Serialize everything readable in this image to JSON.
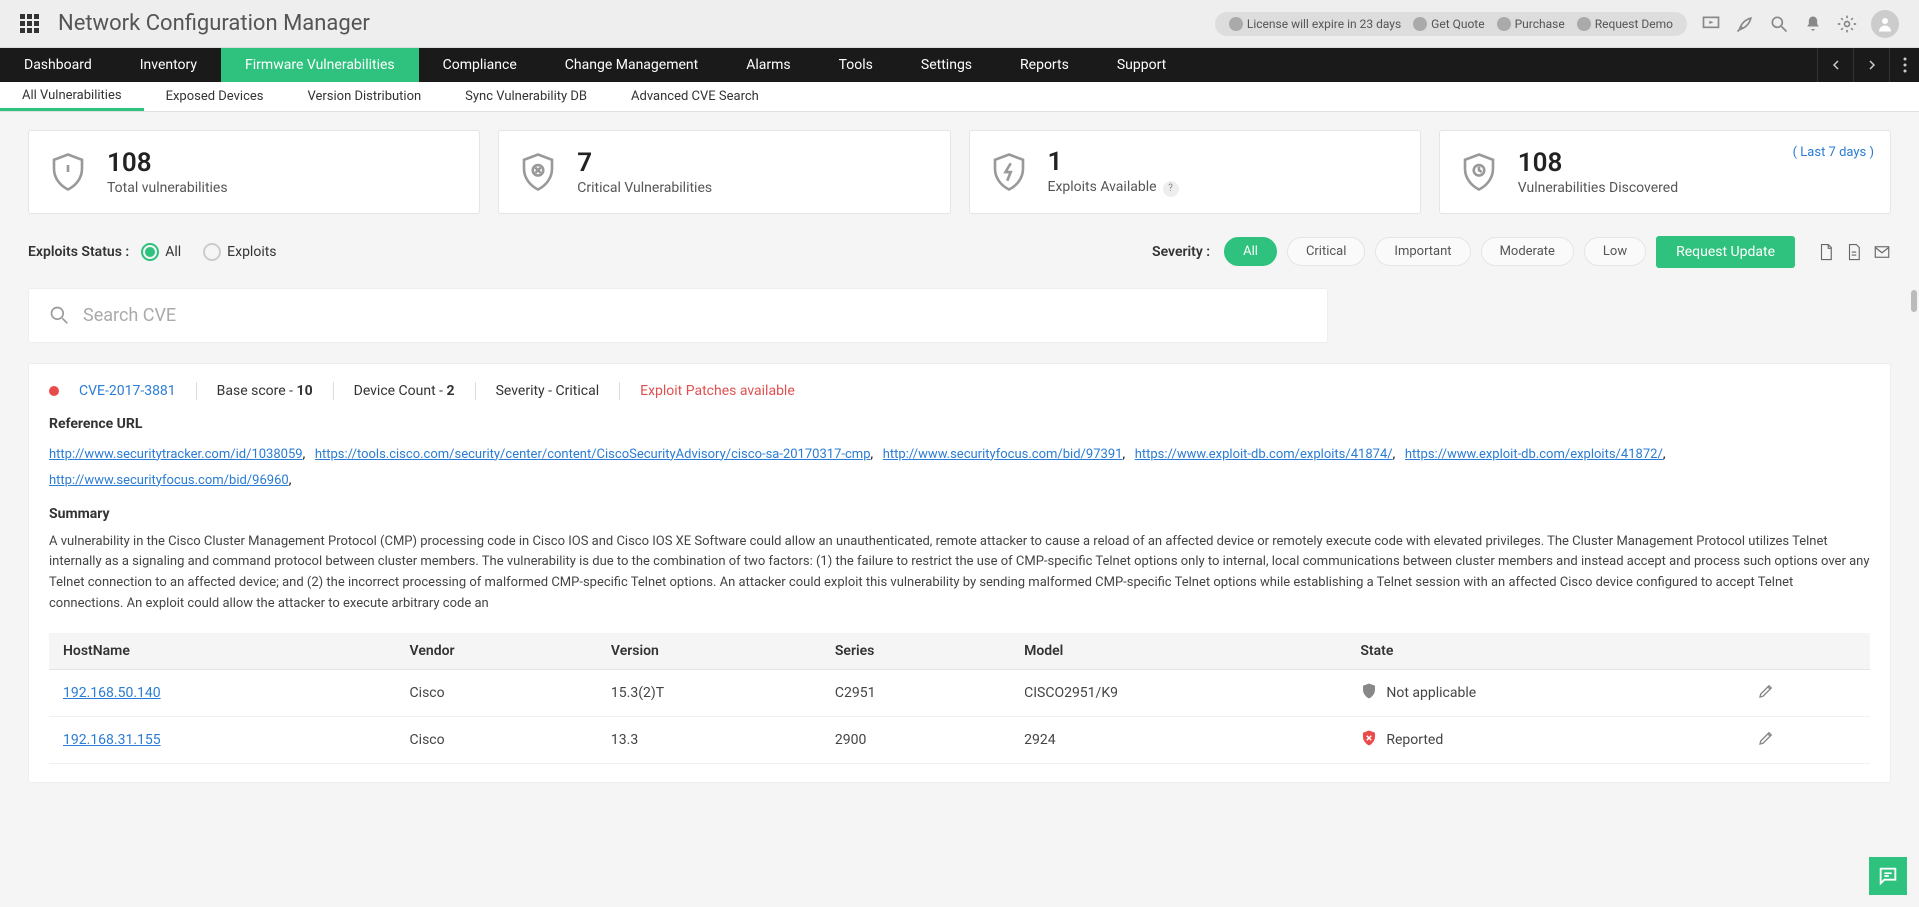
{
  "top": {
    "title": "Network Configuration Manager",
    "license_text": "License will expire in 23 days",
    "get_quote": "Get Quote",
    "purchase": "Purchase",
    "request_demo": "Request Demo"
  },
  "nav": {
    "items": [
      "Dashboard",
      "Inventory",
      "Firmware Vulnerabilities",
      "Compliance",
      "Change Management",
      "Alarms",
      "Tools",
      "Settings",
      "Reports",
      "Support"
    ],
    "active_index": 2
  },
  "subnav": {
    "items": [
      "All Vulnerabilities",
      "Exposed Devices",
      "Version Distribution",
      "Sync Vulnerability DB",
      "Advanced CVE Search"
    ],
    "active_index": 0
  },
  "cards": [
    {
      "value": "108",
      "label": "Total vulnerabilities"
    },
    {
      "value": "7",
      "label": "Critical Vulnerabilities"
    },
    {
      "value": "1",
      "label": "Exploits Available",
      "help": true
    },
    {
      "value": "108",
      "label": "Vulnerabilities Discovered",
      "extra": "( Last 7 days )"
    }
  ],
  "filter": {
    "exploits_label": "Exploits Status :",
    "all": "All",
    "exploits": "Exploits",
    "severity_label": "Severity :",
    "chips": [
      "All",
      "Critical",
      "Important",
      "Moderate",
      "Low"
    ],
    "active_chip": 0,
    "request_update": "Request Update"
  },
  "search": {
    "placeholder": "Search CVE"
  },
  "cve": {
    "id": "CVE-2017-3881",
    "base_score_label": "Base score -",
    "base_score": "10",
    "device_count_label": "Device Count -",
    "device_count": "2",
    "severity_label": "Severity -",
    "severity_value": "Critical",
    "exploit_text": "Exploit Patches available",
    "ref_title": "Reference URL",
    "refs": [
      "http://www.securitytracker.com/id/1038059",
      "https://tools.cisco.com/security/center/content/CiscoSecurityAdvisory/cisco-sa-20170317-cmp",
      "http://www.securityfocus.com/bid/97391",
      "https://www.exploit-db.com/exploits/41874/",
      "https://www.exploit-db.com/exploits/41872/",
      "http://www.securityfocus.com/bid/96960"
    ],
    "summary_title": "Summary",
    "summary": "A vulnerability in the Cisco Cluster Management Protocol (CMP) processing code in Cisco IOS and Cisco IOS XE Software could allow an unauthenticated, remote attacker to cause a reload of an affected device or remotely execute code with elevated privileges. The Cluster Management Protocol utilizes Telnet internally as a signaling and command protocol between cluster members. The vulnerability is due to the combination of two factors: (1) the failure to restrict the use of CMP-specific Telnet options only to internal, local communications between cluster members and instead accept and process such options over any Telnet connection to an affected device; and (2) the incorrect processing of malformed CMP-specific Telnet options. An attacker could exploit this vulnerability by sending malformed CMP-specific Telnet options while establishing a Telnet session with an affected Cisco device configured to accept Telnet connections. An exploit could allow the attacker to execute arbitrary code an",
    "table": {
      "headers": [
        "HostName",
        "Vendor",
        "Version",
        "Series",
        "Model",
        "State",
        ""
      ],
      "rows": [
        {
          "host": "192.168.50.140",
          "vendor": "Cisco",
          "version": "15.3(2)T",
          "series": "C2951",
          "model": "CISCO2951/K9",
          "state": "Not applicable",
          "state_kind": "gray"
        },
        {
          "host": "192.168.31.155",
          "vendor": "Cisco",
          "version": "13.3",
          "series": "2900",
          "model": "2924",
          "state": "Reported",
          "state_kind": "red"
        }
      ]
    }
  }
}
